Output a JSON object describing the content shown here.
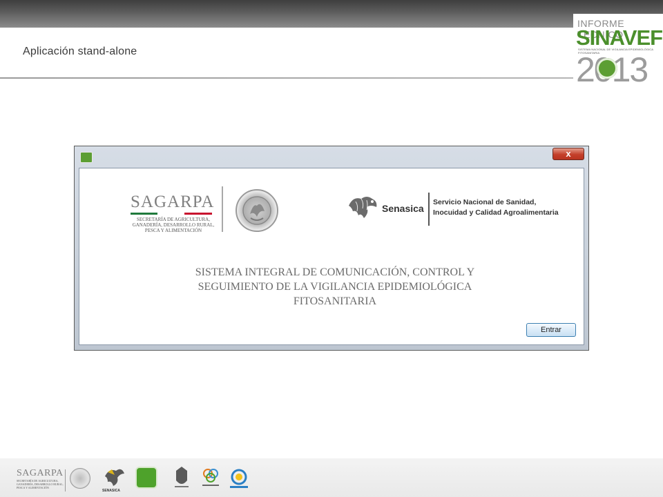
{
  "slide": {
    "title": "Aplicación stand-alone"
  },
  "branding": {
    "line1": "INFORME TECNICO",
    "name": "SINAVEF",
    "tagline": "SISTEMA NACIONAL DE VIGILANCIA EPIDEMIOLÓGICA FITOSANITARIA",
    "year": "2013",
    "accent_color": "#4b8f2c"
  },
  "dialog": {
    "close_label": "x",
    "sagarpa": {
      "name": "SAGARPA",
      "subtitle": "SECRETARÍA DE AGRICULTURA, GANADERÍA, DESARROLLO RURAL, PESCA Y ALIMENTACIÓN",
      "seal_text": "ESTADOS UNIDOS MEXICANOS"
    },
    "senasica": {
      "name": "Senasica",
      "description_line1": "Servicio Nacional de Sanidad,",
      "description_line2": "Inocuidad y Calidad Agroalimentaria"
    },
    "system_title_line1": "SISTEMA INTEGRAL DE COMUNICACIÓN, CONTROL Y",
    "system_title_line2": "SEGUIMIENTO DE LA VIGILANCIA EPIDEMIOLÓGICA",
    "system_title_line3": "FITOSANITARIA",
    "enter_label": "Entrar"
  },
  "footer": {
    "sagarpa_name": "SAGARPA",
    "sagarpa_sub": "SECRETARÍA DE AGRICULTURA, GANADERÍA, DESARROLLO RURAL, PESCA Y ALIMENTACIÓN",
    "senasica_label": "SENASICA"
  }
}
